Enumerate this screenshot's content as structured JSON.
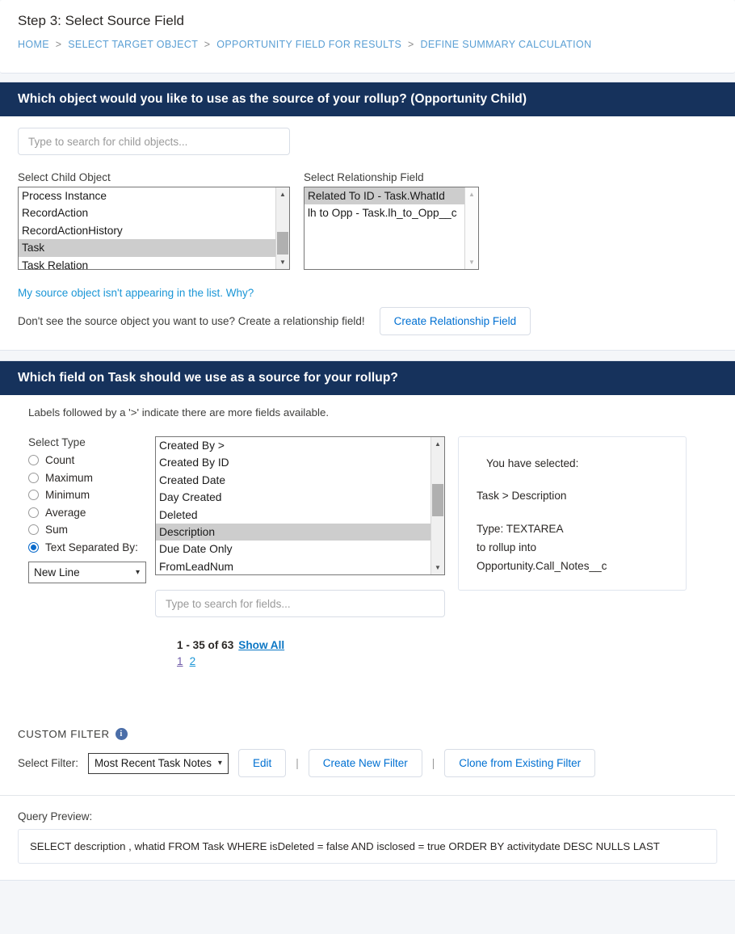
{
  "header": {
    "step_title": "Step 3: Select Source Field",
    "breadcrumb": [
      {
        "label": "HOME"
      },
      {
        "label": "SELECT TARGET OBJECT"
      },
      {
        "label": "OPPORTUNITY FIELD FOR RESULTS"
      },
      {
        "label": "DEFINE SUMMARY CALCULATION"
      }
    ],
    "breadcrumb_separator": ">"
  },
  "source_section": {
    "title": "Which object would you like to use as the source of your rollup? (Opportunity Child)",
    "search_placeholder": "Type to search for child objects...",
    "search_value": "",
    "child_object_label": "Select Child Object",
    "child_objects": [
      {
        "label": "Process Instance",
        "selected": false
      },
      {
        "label": "RecordAction",
        "selected": false
      },
      {
        "label": "RecordActionHistory",
        "selected": false
      },
      {
        "label": "Task",
        "selected": true
      },
      {
        "label": "Task Relation",
        "selected": false
      }
    ],
    "relationship_field_label": "Select Relationship Field",
    "relationship_fields": [
      {
        "label": "Related To ID - Task.WhatId",
        "selected": true
      },
      {
        "label": "lh to Opp - Task.lh_to_Opp__c",
        "selected": false
      }
    ],
    "help_link": "My source object isn't appearing in the list. Why?",
    "create_prompt": "Don't see the source object you want to use? Create a relationship field!",
    "create_button": "Create Relationship Field"
  },
  "field_section": {
    "title": "Which field on Task should we use as a source for your rollup?",
    "hint": "Labels followed by a '>' indicate there are more fields available.",
    "type_label": "Select Type",
    "types": [
      {
        "label": "Count",
        "selected": false
      },
      {
        "label": "Maximum",
        "selected": false
      },
      {
        "label": "Minimum",
        "selected": false
      },
      {
        "label": "Average",
        "selected": false
      },
      {
        "label": "Sum",
        "selected": false
      },
      {
        "label": "Text Separated By:",
        "selected": true
      }
    ],
    "separator_value": "New Line",
    "fields": [
      {
        "label": "Created By >",
        "selected": false
      },
      {
        "label": "Created By ID",
        "selected": false
      },
      {
        "label": "Created Date",
        "selected": false
      },
      {
        "label": "Day Created",
        "selected": false
      },
      {
        "label": "Deleted",
        "selected": false
      },
      {
        "label": "Description",
        "selected": true
      },
      {
        "label": "Due Date Only",
        "selected": false
      },
      {
        "label": "FromLeadNum",
        "selected": false
      }
    ],
    "field_search_placeholder": "Type to search for fields...",
    "field_search_value": "",
    "paging_count": "1 - 35 of 63",
    "show_all": "Show All",
    "page_links": [
      "1",
      "2"
    ],
    "selected_panel": {
      "heading": "You have selected:",
      "path": "Task > Description",
      "type_line": "Type: TEXTAREA",
      "rollup_line": "to rollup into",
      "target_line": "Opportunity.Call_Notes__c"
    }
  },
  "custom_filter": {
    "title": "CUSTOM FILTER",
    "info_glyph": "i",
    "select_filter_label": "Select Filter:",
    "selected_filter": "Most Recent Task Notes",
    "edit_button": "Edit",
    "create_button": "Create New Filter",
    "clone_button": "Clone from Existing Filter",
    "separator": "|"
  },
  "query_preview": {
    "label": "Query Preview:",
    "query": "SELECT description , whatid FROM Task WHERE isDeleted = false AND isclosed = true ORDER BY activitydate DESC NULLS LAST"
  },
  "icons": {
    "scroll_up": "▲",
    "scroll_down": "▼",
    "chevron_down": "⌄"
  }
}
